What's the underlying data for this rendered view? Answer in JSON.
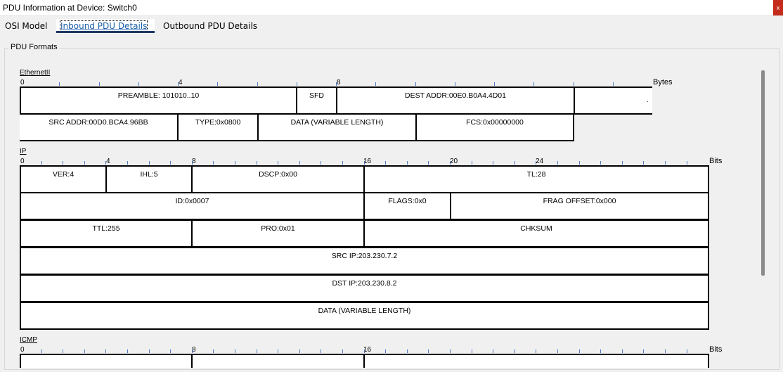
{
  "window": {
    "title": "PDU Information at Device: Switch0",
    "close_label": "x"
  },
  "tabs": [
    {
      "label": "OSI Model"
    },
    {
      "label": "Inbound PDU Details"
    },
    {
      "label": "Outbound PDU Details"
    }
  ],
  "group_label": "PDU Formats",
  "ethernet": {
    "label": "EthernetII",
    "unit": "Bytes",
    "ruler": [
      "0",
      "4",
      "8"
    ],
    "fields": {
      "preamble": "PREAMBLE: 101010..10",
      "sfd": "SFD",
      "dest": "DEST ADDR:00E0.B0A4.4D01",
      "extra": ".",
      "src": "SRC ADDR:00D0.BCA4.96BB",
      "type": "TYPE:0x0800",
      "data": "DATA (VARIABLE LENGTH)",
      "fcs": "FCS:0x00000000"
    }
  },
  "ip": {
    "label": "IP",
    "unit": "Bits",
    "ruler": [
      "0",
      "4",
      "8",
      "16",
      "20",
      "24"
    ],
    "fields": {
      "ver": "VER:4",
      "ihl": "IHL:5",
      "dscp": "DSCP:0x00",
      "tl": "TL:28",
      "id": "ID:0x0007",
      "flags": "FLAGS:0x0",
      "frag": "FRAG OFFSET:0x000",
      "ttl": "TTL:255",
      "pro": "PRO:0x01",
      "chksum": "CHKSUM",
      "src": "SRC IP:203.230.7.2",
      "dst": "DST IP:203.230.8.2",
      "data": "DATA (VARIABLE LENGTH)"
    }
  },
  "icmp": {
    "label": "ICMP",
    "unit": "Bits",
    "ruler": [
      "0",
      "8",
      "16"
    ]
  }
}
